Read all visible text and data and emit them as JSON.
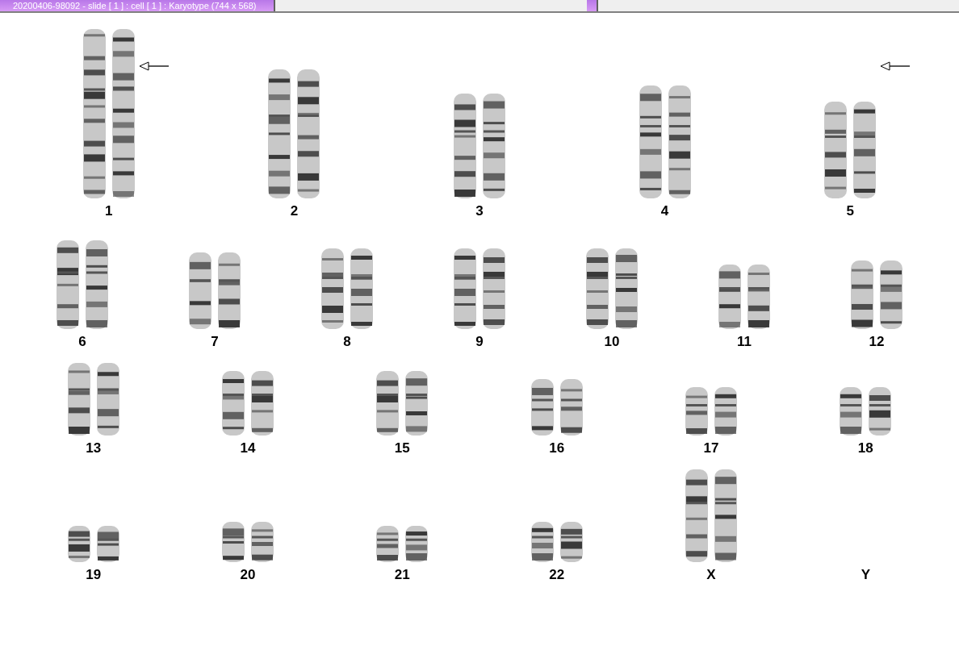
{
  "window": {
    "tabs": [
      {
        "label": "20200406-98092 - slide [ 1 ] : cell [ 1 ] : Karyotype  (744 x 568)",
        "selected": true
      }
    ]
  },
  "karyotype": {
    "rows": [
      [
        {
          "label": "1",
          "kind": "pair",
          "arrow": true
        },
        {
          "label": "2",
          "kind": "pair",
          "arrow": false
        },
        {
          "label": "3",
          "kind": "pair",
          "arrow": false
        },
        {
          "label": "4",
          "kind": "pair",
          "arrow": false
        },
        {
          "label": "5",
          "kind": "pair",
          "arrow": true
        }
      ],
      [
        {
          "label": "6",
          "kind": "pair",
          "arrow": false
        },
        {
          "label": "7",
          "kind": "pair",
          "arrow": false
        },
        {
          "label": "8",
          "kind": "pair",
          "arrow": false
        },
        {
          "label": "9",
          "kind": "pair",
          "arrow": false
        },
        {
          "label": "10",
          "kind": "pair",
          "arrow": false
        },
        {
          "label": "11",
          "kind": "pair",
          "arrow": false
        },
        {
          "label": "12",
          "kind": "pair",
          "arrow": false
        }
      ],
      [
        {
          "label": "13",
          "kind": "pair",
          "arrow": false
        },
        {
          "label": "14",
          "kind": "pair",
          "arrow": false
        },
        {
          "label": "15",
          "kind": "pair",
          "arrow": false
        },
        {
          "label": "16",
          "kind": "pair",
          "arrow": false
        },
        {
          "label": "17",
          "kind": "pair",
          "arrow": false
        },
        {
          "label": "18",
          "kind": "pair",
          "arrow": false
        }
      ],
      [
        {
          "label": "19",
          "kind": "pair",
          "arrow": false
        },
        {
          "label": "20",
          "kind": "pair",
          "arrow": false
        },
        {
          "label": "21",
          "kind": "pair",
          "arrow": false
        },
        {
          "label": "22",
          "kind": "pair",
          "arrow": false
        },
        {
          "label": "X",
          "kind": "pair",
          "arrow": false
        },
        {
          "label": "Y",
          "kind": "empty",
          "arrow": false
        }
      ]
    ]
  }
}
